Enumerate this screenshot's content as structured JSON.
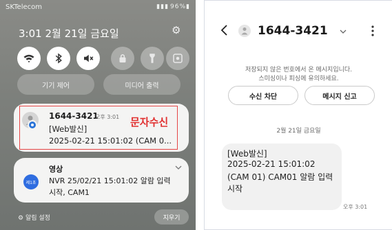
{
  "status_bar": {
    "carrier": "SKTelecom",
    "battery": "96%"
  },
  "shade": {
    "clock": "3:01",
    "date": "2월 21일 금요일",
    "quick_settings": [
      {
        "icon": "wifi-icon",
        "on": true
      },
      {
        "icon": "bluetooth-icon",
        "on": true
      },
      {
        "icon": "mute-icon",
        "on": true
      },
      {
        "icon": "lock-icon",
        "on": false
      },
      {
        "icon": "flashlight-icon",
        "on": false
      },
      {
        "icon": "screen-capture-icon",
        "on": false
      }
    ],
    "device_control_label": "기기 제어",
    "media_output_label": "미디어 출력",
    "sms_notification": {
      "sender": "1644-3421",
      "time": "오후 3:01",
      "line1": "[Web발신]",
      "line2": "2025-02-21 15:01:02 (CAM 0..."
    },
    "annotation_label": "문자수신",
    "video_notification": {
      "app": "영상",
      "app_icon_text": "제1초",
      "line1": "NVR 25/02/21 15:01:02 알람 입력",
      "line2": "시작, CAM1"
    },
    "notification_settings_label": "알림 설정",
    "clear_label": "지우기"
  },
  "messages": {
    "contact": "1644-3421",
    "warning_line1": "저장되지 않은 번호에서 온 메시지입니다.",
    "warning_line2": "스미싱이나 피싱에 유의하세요.",
    "block_label": "수신 차단",
    "report_label": "메시지 신고",
    "date_separator": "2월 21일 금요일",
    "message_lines": [
      "[Web발신]",
      "2025-02-21 15:01:02",
      "(CAM 01) CAM01 알람 입력",
      "시작"
    ],
    "message_time": "오후 3:01"
  },
  "colors": {
    "annotation_red": "#e13030",
    "badge_blue": "#2a74d8"
  }
}
